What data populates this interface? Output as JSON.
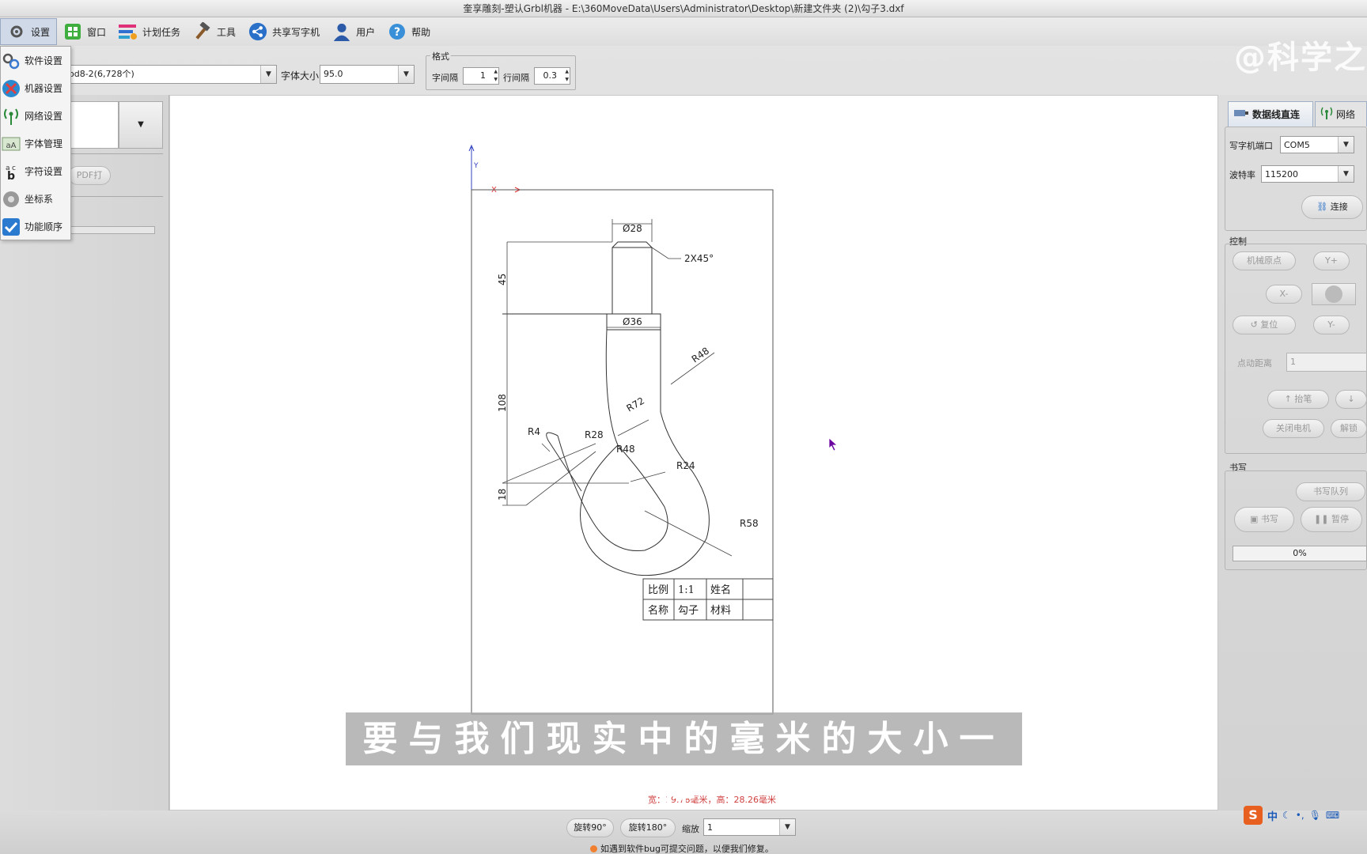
{
  "window": {
    "title": "奎享雕刻-塑认Grbl机器 - E:\\360MoveData\\Users\\Administrator\\Desktop\\新建文件夹 (2)\\勾子3.dxf"
  },
  "menu": {
    "items": [
      {
        "label": "设置",
        "icon": "gear-icon"
      },
      {
        "label": "窗口",
        "icon": "window-icon"
      },
      {
        "label": "计划任务",
        "icon": "task-icon"
      },
      {
        "label": "工具",
        "icon": "hammer-icon"
      },
      {
        "label": "共享写字机",
        "icon": "share-icon"
      },
      {
        "label": "用户",
        "icon": "user-icon"
      },
      {
        "label": "帮助",
        "icon": "help-icon"
      }
    ]
  },
  "settings_dropdown": {
    "items": [
      {
        "label": "软件设置",
        "icon": "gears-icon"
      },
      {
        "label": "机器设置",
        "icon": "tools-icon"
      },
      {
        "label": "网络设置",
        "icon": "antenna-icon"
      },
      {
        "label": "字体管理",
        "icon": "font-icon"
      },
      {
        "label": "字符设置",
        "icon": "char-icon"
      },
      {
        "label": "坐标系",
        "icon": "coordinate-icon"
      },
      {
        "label": "功能顺序",
        "icon": "check-icon"
      }
    ]
  },
  "watermark": "@科学之",
  "toolbar": {
    "font_combo_value": "od8-2(6,728个)",
    "font_size_label": "字体大小",
    "font_size_value": "95.0",
    "format_group_label": "格式",
    "char_spacing_label": "字间隔",
    "char_spacing_value": "1",
    "line_spacing_label": "行间隔",
    "line_spacing_value": "0.3"
  },
  "left_panel": {
    "pdf_button": "PDF打"
  },
  "drawing": {
    "axis_y": "Y",
    "axis_x": "X",
    "dims": {
      "d28": "Ø28",
      "chamfer": "2X45°",
      "d36": "Ø36",
      "h45": "45",
      "h108": "108",
      "h18": "18",
      "r48a": "R48",
      "r72": "R72",
      "r4": "R4",
      "r28": "R28",
      "r48b": "R48",
      "r24": "R24",
      "r58": "R58"
    },
    "title_block": {
      "scale_label": "比例",
      "scale_value": "1:1",
      "name_label": "姓名",
      "part_label": "名称",
      "part_value": "勾子",
      "material_label": "材料"
    }
  },
  "right_panel": {
    "tab_usb": "数据线直连",
    "tab_network": "网络",
    "port_label": "写字机端口",
    "port_value": "COM5",
    "baud_label": "波特率",
    "baud_value": "115200",
    "connect_button": "连接",
    "control_label": "控制",
    "home_button": "机械原点",
    "y_plus": "Y+",
    "x_minus": "X-",
    "reset_button": "复位",
    "y_minus": "Y-",
    "step_label": "点动距离",
    "step_value": "1",
    "pen_up_button": "抬笔",
    "motor_off_button": "关闭电机",
    "unlock_button": "解锁",
    "write_label": "书写",
    "write_queue_button": "书写队列",
    "write_button": "书写",
    "pause_button": "暂停",
    "progress_text": "0%",
    "progress": 0
  },
  "canvas": {
    "size_readout": "宽：19.78毫米，高：28.26毫米"
  },
  "subtitle": "要与我们现实中的毫米的大小一样",
  "bottom": {
    "rotate90": "旋转90°",
    "rotate180": "旋转180°",
    "zoom_label": "缩放",
    "zoom_value": "1",
    "bug_notice": "如遇到软件bug可提交问题，以便我们修复。"
  },
  "ime": {
    "lang": "中"
  },
  "colors": {
    "axis_red": "#e03030",
    "axis_blue": "#3040c0",
    "readout_red": "#d04040",
    "cursor_purple": "#6a00a0"
  }
}
